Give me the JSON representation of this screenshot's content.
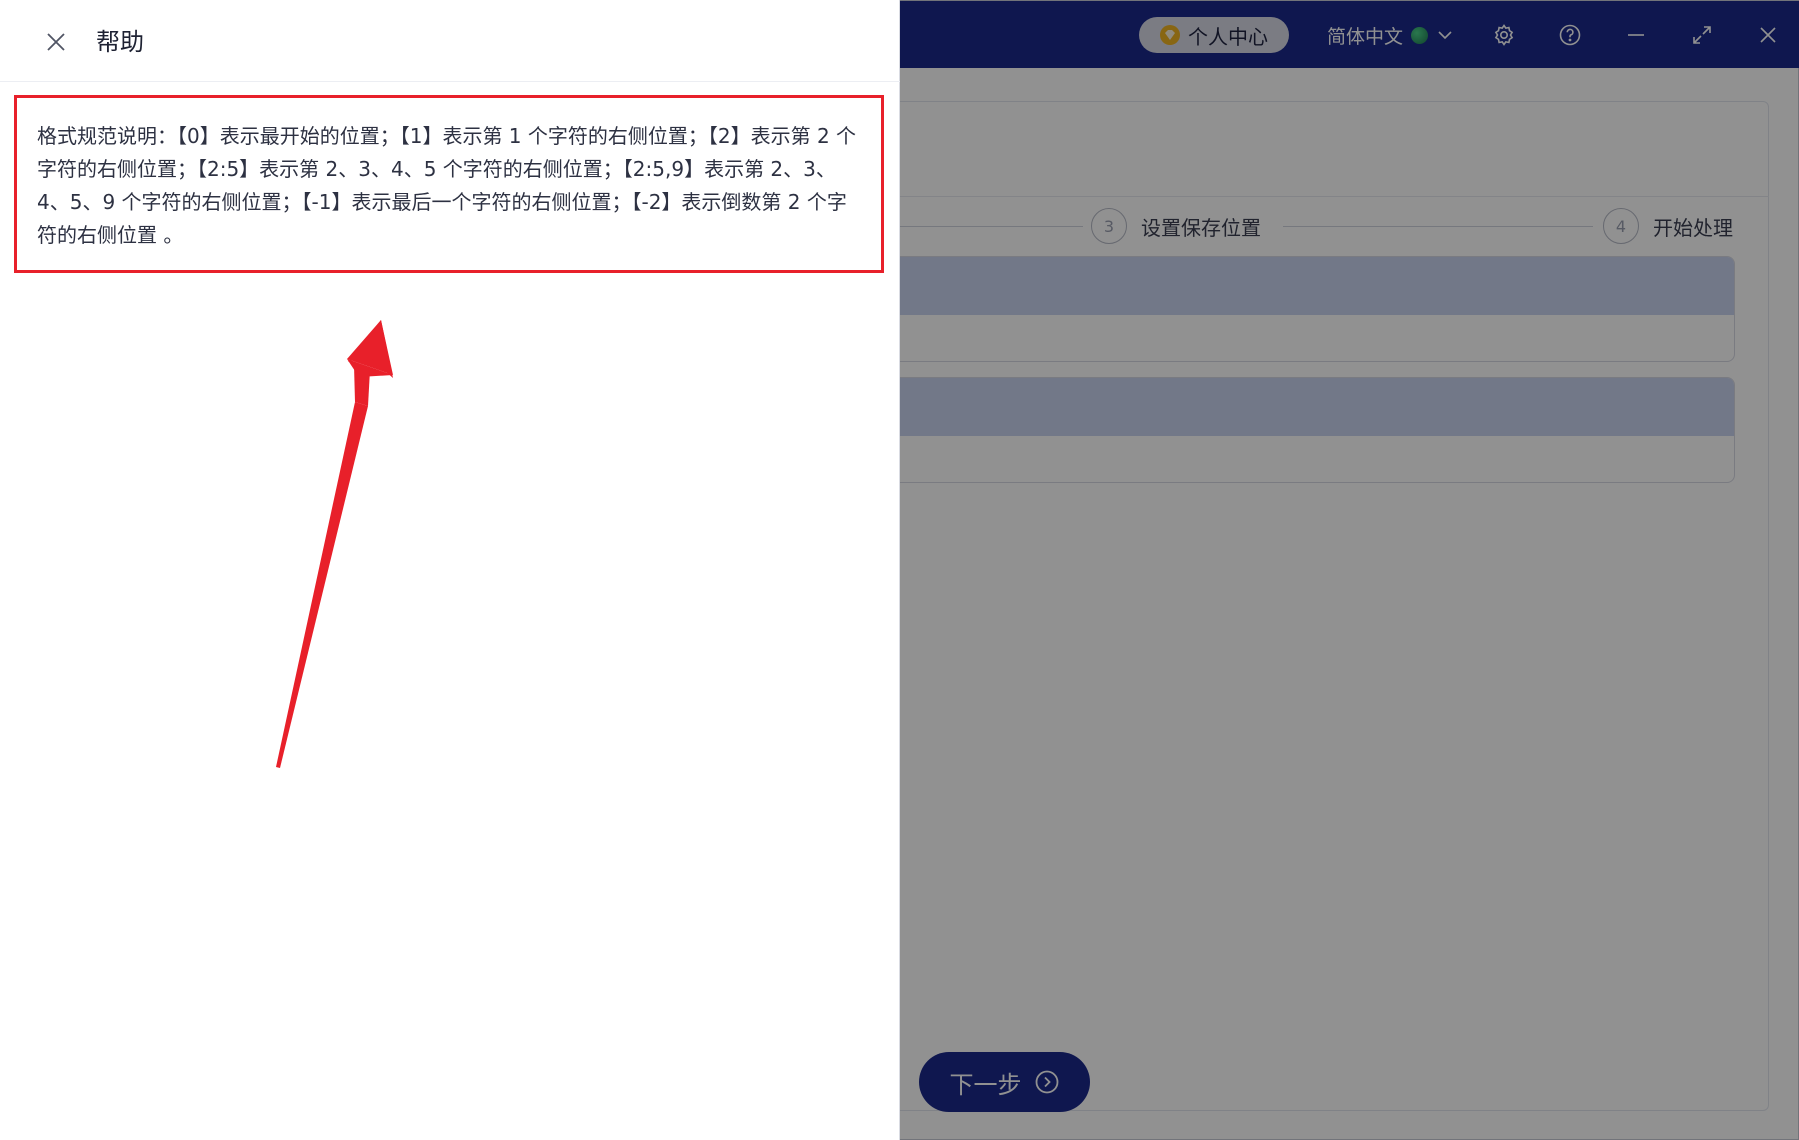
{
  "titlebar": {
    "vip_label": "个人中心",
    "language": "简体中文",
    "icons": [
      "chevron-down-icon",
      "gear-icon",
      "help-icon",
      "minimize-icon",
      "maximize-icon",
      "close-icon"
    ]
  },
  "steps": [
    {
      "number": "3",
      "label": "设置保存位置"
    },
    {
      "number": "4",
      "label": "开始处理"
    }
  ],
  "next_button": {
    "label": "下一步"
  },
  "drawer": {
    "title": "帮助",
    "help_text": "格式规范说明：【0】表示最开始的位置；【1】表示第 1 个字符的右侧位置；【2】表示第 2 个字符的右侧位置；【2:5】表示第 2、3、4、5 个字符的右侧位置；【2:5,9】表示第 2、3、4、5、9 个字符的右侧位置；【-1】表示最后一个字符的右侧位置；【-2】表示倒数第 2 个字符的右侧位置 。"
  },
  "colors": {
    "titlebar": "#1b2a8c",
    "highlight_border": "#e8202a",
    "arrow": "#e8202a"
  }
}
